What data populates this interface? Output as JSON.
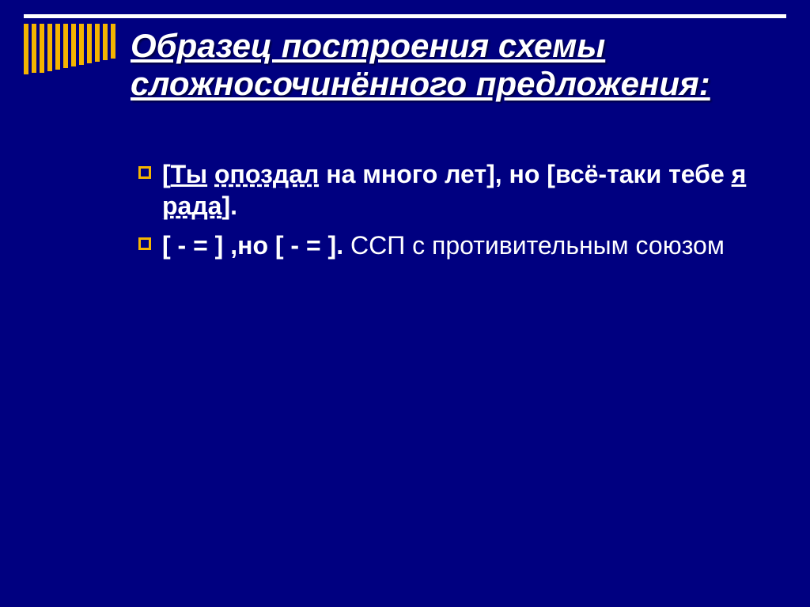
{
  "title": "Образец  построения схемы сложносочинённого предложения:",
  "bullets": [
    {
      "open_bracket": "[",
      "subj1": "Ты",
      "pred1_dashed": "опоздал",
      "mid1": " на много лет], но [всё-таки тебе ",
      "subj2": "я",
      "space": " ",
      "pred2_dashed": "рада",
      "end": "]."
    },
    {
      "scheme_bold": "[ - =   ] ,но [ - =   ].",
      "tail": " ССП с противительным союзом"
    }
  ]
}
